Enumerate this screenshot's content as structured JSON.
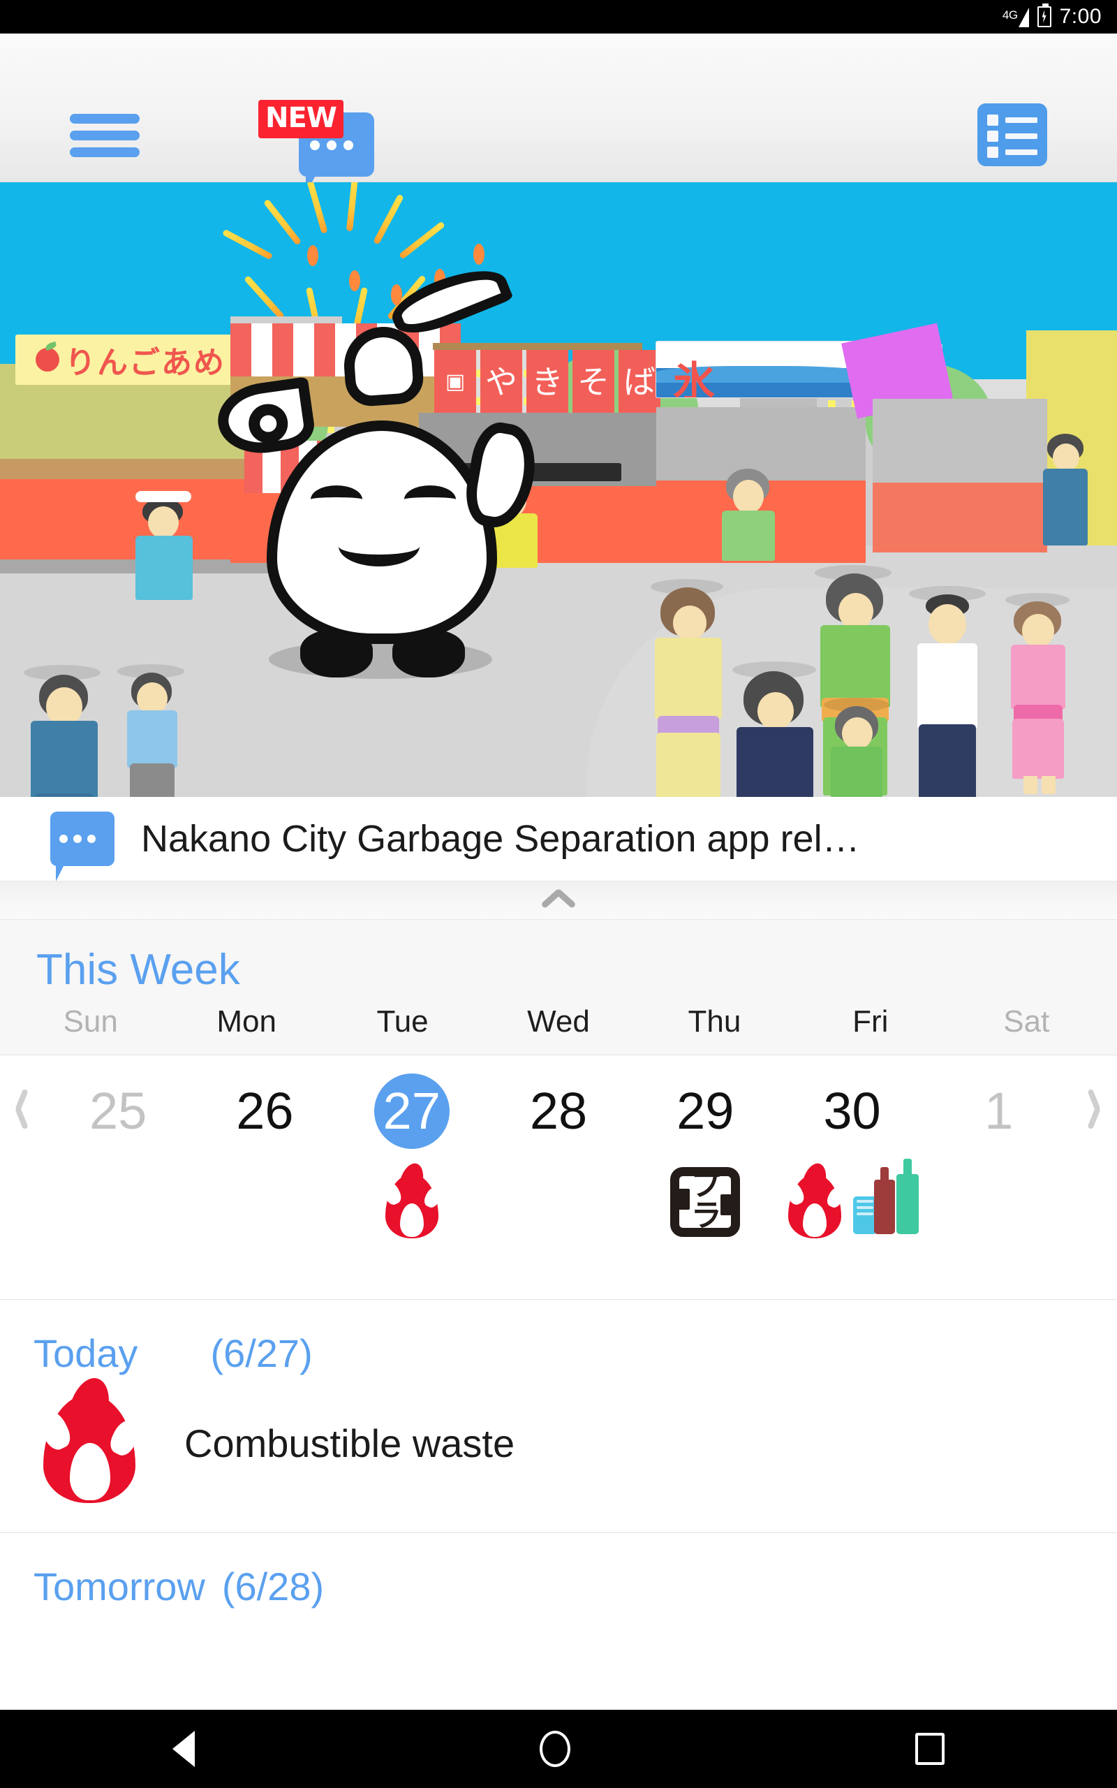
{
  "status_bar": {
    "network": "4G",
    "time": "7:00",
    "battery_icon": "battery-charging-icon",
    "signal_icon": "signal-bars-icon"
  },
  "app_bar": {
    "menu_icon": "hamburger-menu-icon",
    "news_icon": "speech-bubble-icon",
    "news_badge": "NEW",
    "list_icon": "list-view-icon"
  },
  "hero": {
    "alt": "Nakano City garbage bag mascot at a summer festival street scene",
    "signs": {
      "candy_apple": "りんごあめ",
      "yakisoba": [
        "や",
        "き",
        "そ",
        "ば"
      ],
      "shaved_ice": "氷"
    }
  },
  "news": {
    "icon": "speech-bubble-icon",
    "headline": "Nakano City Garbage Separation app rel…"
  },
  "handle": {
    "icon": "chevron-up-icon"
  },
  "week": {
    "title": "This Week",
    "prev_icon": "chevron-left-icon",
    "next_icon": "chevron-right-icon",
    "day_names": [
      "Sun",
      "Mon",
      "Tue",
      "Wed",
      "Thu",
      "Fri",
      "Sat"
    ],
    "days": [
      {
        "num": "25",
        "muted": true,
        "today": false,
        "icons": []
      },
      {
        "num": "26",
        "muted": false,
        "today": false,
        "icons": []
      },
      {
        "num": "27",
        "muted": false,
        "today": true,
        "icons": [
          "flame-icon"
        ]
      },
      {
        "num": "28",
        "muted": false,
        "today": false,
        "icons": []
      },
      {
        "num": "29",
        "muted": false,
        "today": false,
        "icons": [
          "plastic-recycle-icon"
        ]
      },
      {
        "num": "30",
        "muted": false,
        "today": false,
        "icons": [
          "flame-icon",
          "bottles-cans-icon"
        ]
      },
      {
        "num": "1",
        "muted": true,
        "today": false,
        "icons": []
      }
    ],
    "plastic_mark_text": "プラ"
  },
  "schedule": [
    {
      "label": "Today",
      "date": "(6/27)",
      "items": [
        {
          "icon": "flame-icon",
          "name": "Combustible waste"
        }
      ]
    },
    {
      "label": "Tomorrow",
      "date": "(6/28)",
      "items": []
    }
  ],
  "nav_bar": {
    "back_icon": "back-triangle-icon",
    "home_icon": "home-circle-icon",
    "recents_icon": "recents-square-icon"
  },
  "colors": {
    "accent_blue": "#5aa0ef",
    "badge_red": "#fb2330",
    "flame_red": "#e8102a",
    "sky_blue": "#12b6e9",
    "muted_gray": "#c3c3c3"
  }
}
